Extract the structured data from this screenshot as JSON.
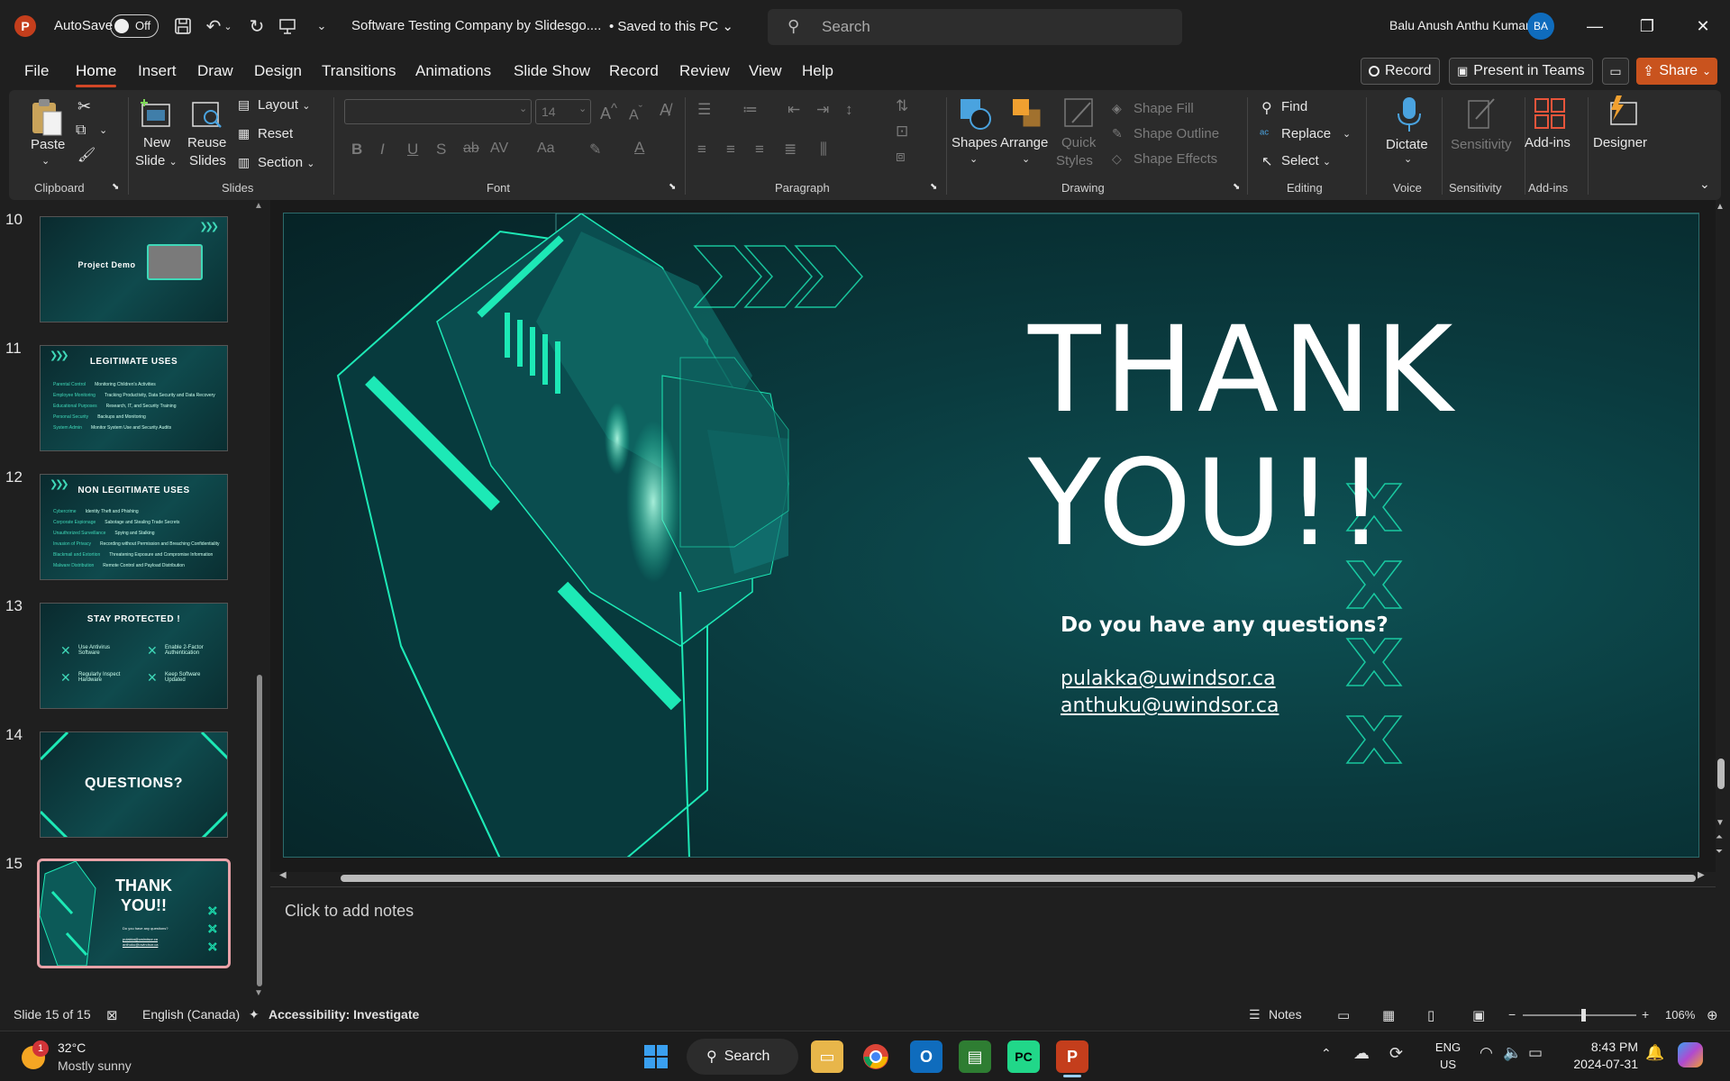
{
  "titlebar": {
    "app_logo": "P",
    "autosave_label": "AutoSave",
    "autosave_state": "Off",
    "doc_title": "Software Testing Company by Slidesgo....",
    "saved_status": "• Saved to this PC",
    "search_placeholder": "Search",
    "user_name": "Balu Anush Anthu Kumar",
    "user_initials": "BA"
  },
  "menu": {
    "tabs": [
      "File",
      "Home",
      "Insert",
      "Draw",
      "Design",
      "Transitions",
      "Animations",
      "Slide Show",
      "Record",
      "Review",
      "View",
      "Help"
    ],
    "active_tab": "Home",
    "record_label": "Record",
    "present_label": "Present in Teams",
    "share_label": "Share"
  },
  "ribbon": {
    "clipboard": {
      "paste": "Paste",
      "group": "Clipboard"
    },
    "slides": {
      "new_slide": "New",
      "new_slide_2": "Slide",
      "reuse": "Reuse",
      "reuse_2": "Slides",
      "layout": "Layout",
      "reset": "Reset",
      "section": "Section",
      "group": "Slides"
    },
    "font": {
      "font_name": "",
      "font_size": "14",
      "group": "Font"
    },
    "paragraph": {
      "group": "Paragraph"
    },
    "drawing": {
      "shapes": "Shapes",
      "arrange": "Arrange",
      "quick": "Quick",
      "styles": "Styles",
      "shape_fill": "Shape Fill",
      "shape_outline": "Shape Outline",
      "shape_effects": "Shape Effects",
      "group": "Drawing"
    },
    "editing": {
      "find": "Find",
      "replace": "Replace",
      "select": "Select",
      "group": "Editing"
    },
    "voice": {
      "dictate": "Dictate",
      "group": "Voice"
    },
    "sensitivity": {
      "label": "Sensitivity",
      "group": "Sensitivity"
    },
    "addins": {
      "label": "Add-ins",
      "group": "Add-ins"
    },
    "designer": {
      "label": "Designer"
    }
  },
  "thumbnails": [
    {
      "num": "10",
      "title": "Project Demo"
    },
    {
      "num": "11",
      "title": "LEGITIMATE USES",
      "rows": [
        [
          "Parental Control",
          "Monitoring Children's Activities"
        ],
        [
          "Employee Monitoring",
          "Tracking Productivity, Data Security and Data Recovery"
        ],
        [
          "Educational Purposes",
          "Research, IT, and Security Training"
        ],
        [
          "Personal Security",
          "Backups and Monitoring"
        ],
        [
          "System Admin",
          "Monitor System Use and Security Audits"
        ]
      ]
    },
    {
      "num": "12",
      "title": "NON LEGITIMATE USES",
      "rows": [
        [
          "Cybercrime",
          "Identity Theft and Phishing"
        ],
        [
          "Corporate Espionage",
          "Sabotage and Stealing Trade Secrets"
        ],
        [
          "Unauthorized Surveillance",
          "Spying and Stalking"
        ],
        [
          "Invasion of Privacy",
          "Recording without Permission and Breaching Confidentiality"
        ],
        [
          "Blackmail and Extortion",
          "Threatening Exposure and Compromise Information"
        ],
        [
          "Malware Distribution",
          "Remote Control and Payload Distribution"
        ]
      ]
    },
    {
      "num": "13",
      "title": "STAY PROTECTED !",
      "items": [
        "Use Antivirus Software",
        "Enable 2-Factor Authentication",
        "Regularly Inspect Hardware",
        "Keep Software Updated"
      ]
    },
    {
      "num": "14",
      "title": "QUESTIONS?"
    },
    {
      "num": "15",
      "title": "THANK YOU!!",
      "title_line1": "THANK",
      "title_line2": "YOU!!"
    }
  ],
  "slide": {
    "title_line1": "THANK",
    "title_line2": "YOU!!",
    "question": "Do you have any questions?",
    "email1": "pulakka@uwindsor.ca",
    "email2": "anthuku@uwindsor.ca",
    "accent_color": "#1de9b6",
    "bg_color": "#0a3a3e"
  },
  "notes": {
    "placeholder": "Click to add notes"
  },
  "statusbar": {
    "slide_info": "Slide 15 of 15",
    "language": "English (Canada)",
    "accessibility": "Accessibility: Investigate",
    "notes_label": "Notes",
    "zoom": "106%",
    "zoom_fraction": 0.53
  },
  "taskbar": {
    "weather_temp": "32°C",
    "weather_desc": "Mostly sunny",
    "weather_badge": "1",
    "search_label": "Search",
    "lang_line1": "ENG",
    "lang_line2": "US",
    "time": "8:43 PM",
    "date": "2024-07-31"
  }
}
